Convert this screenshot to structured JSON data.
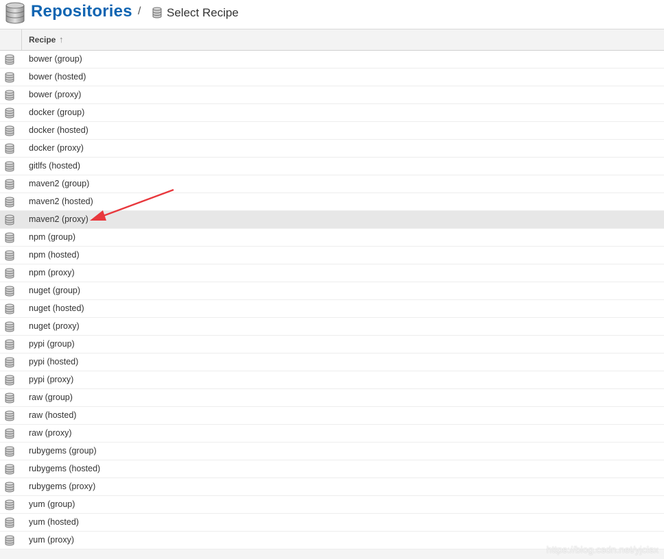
{
  "header": {
    "title": "Repositories",
    "separator": "/",
    "breadcrumb": "Select Recipe",
    "icon": "database-icon"
  },
  "grid": {
    "column_header": "Recipe",
    "sort_indicator": "↑",
    "rows": [
      {
        "name": "bower (group)"
      },
      {
        "name": "bower (hosted)"
      },
      {
        "name": "bower (proxy)"
      },
      {
        "name": "docker (group)"
      },
      {
        "name": "docker (hosted)"
      },
      {
        "name": "docker (proxy)"
      },
      {
        "name": "gitlfs (hosted)"
      },
      {
        "name": "maven2 (group)"
      },
      {
        "name": "maven2 (hosted)"
      },
      {
        "name": "maven2 (proxy)",
        "selected": true
      },
      {
        "name": "npm (group)"
      },
      {
        "name": "npm (hosted)"
      },
      {
        "name": "npm (proxy)"
      },
      {
        "name": "nuget (group)"
      },
      {
        "name": "nuget (hosted)"
      },
      {
        "name": "nuget (proxy)"
      },
      {
        "name": "pypi (group)"
      },
      {
        "name": "pypi (hosted)"
      },
      {
        "name": "pypi (proxy)"
      },
      {
        "name": "raw (group)"
      },
      {
        "name": "raw (hosted)"
      },
      {
        "name": "raw (proxy)"
      },
      {
        "name": "rubygems (group)"
      },
      {
        "name": "rubygems (hosted)"
      },
      {
        "name": "rubygems (proxy)"
      },
      {
        "name": "yum (group)"
      },
      {
        "name": "yum (hosted)"
      },
      {
        "name": "yum (proxy)"
      }
    ]
  },
  "annotation": {
    "arrow_color": "#e8383d",
    "points_to": "maven2 (proxy)"
  },
  "watermark": "https://blog.csdn.net/yjclsx",
  "colors": {
    "title": "#1165b2",
    "selected_row": "#e7e7e7"
  }
}
